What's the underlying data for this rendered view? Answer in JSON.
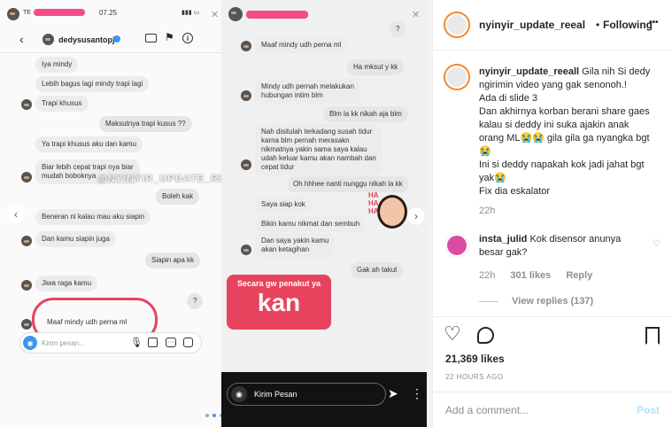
{
  "left_story": {
    "status_time": "07.25",
    "status_left": "TE",
    "dm_username": "dedysusantopj",
    "watermark": "@NYINYIR_UPDATE_REEALL",
    "input_placeholder": "Kirim pesan...",
    "messages": [
      {
        "text": "Iya mindy",
        "side": "them"
      },
      {
        "text": "Lebih bagus lagi mindy trapi lagi",
        "side": "them"
      },
      {
        "text": "Trapi khusus",
        "side": "them"
      },
      {
        "text": "Maksutnya trapi kusus ??",
        "side": "me"
      },
      {
        "text": "Ya trapi khusus aku dan kamu",
        "side": "them"
      },
      {
        "text": "Biar lebih cepat trapi nya biar\nmudah boboknya",
        "side": "them"
      },
      {
        "text": "Boleh kak",
        "side": "me"
      },
      {
        "text": "Beneran ni kalau mau aku siapin",
        "side": "them"
      },
      {
        "text": "Dan kamu siapin juga",
        "side": "them"
      },
      {
        "text": "Siapin apa kk",
        "side": "me"
      },
      {
        "text": "Jiwa raga kamu",
        "side": "them"
      },
      {
        "text": "?",
        "side": "me"
      },
      {
        "text": "Maaf mindy udh perna ml",
        "side": "them"
      }
    ]
  },
  "right_story": {
    "messages": [
      {
        "text": "?",
        "side": "me"
      },
      {
        "text": "Maaf mindy udh perna ml",
        "side": "them"
      },
      {
        "text": "Ha mksut y kk",
        "side": "me"
      },
      {
        "text": "Mindy udh pernah melakukan\nhubungan intim blm",
        "side": "them"
      },
      {
        "text": "Blm la kk nikah aja blm",
        "side": "me"
      },
      {
        "text": "Nah disitulah terkadang susah tidur\nkarna blm pernah merasakn\nnikmatnya yakin sama saya kalau\nudah keluar kamu akan nambah dan\ncepat tidur",
        "side": "them"
      },
      {
        "text": "Oh hhhee nanti nunggu nikah la kk",
        "side": "me"
      },
      {
        "text": "Saya siap kok",
        "side": "them"
      },
      {
        "text": "Bikin kamu nikmat dan sembuh",
        "side": "them"
      },
      {
        "text": "Dan saya yakin kamu\nakan ketagihan",
        "side": "them"
      },
      {
        "text": "Gak ah takut",
        "side": "me"
      }
    ],
    "sticker_text": "HA HA HA",
    "caption_small": "Secara gw penakut ya",
    "caption_big": "kan",
    "reply_placeholder": "Kirim Pesan"
  },
  "post": {
    "header_username": "nyinyir_update_reeal",
    "follow_label": "Following",
    "caption_username": "nyinyir_update_reeall",
    "caption_lines": [
      "Gila nih Si dedy",
      "ngirimin video yang gak senonoh.!",
      "Ada di slide 3",
      "Dan akhirnya korban berani share gaes",
      "kalau si deddy ini suka ajakin anak",
      "orang ML😭😭 gila gila ga nyangka bgt",
      "😭",
      "Ini si deddy napakah kok jadi jahat bgt",
      "yak😭",
      "Fix dia eskalator"
    ],
    "caption_time": "22h",
    "comment": {
      "username": "insta_julid",
      "text_line1": "Kok disensor anunya",
      "text_line2": "besar gak?",
      "time": "22h",
      "likes": "301 likes",
      "reply": "Reply",
      "view_replies": "View replies (137)"
    },
    "likes_count": "21,369 likes",
    "timestamp": "22 HOURS AGO",
    "add_comment_placeholder": "Add a comment...",
    "post_button": "Post",
    "more_dots": "•••"
  }
}
